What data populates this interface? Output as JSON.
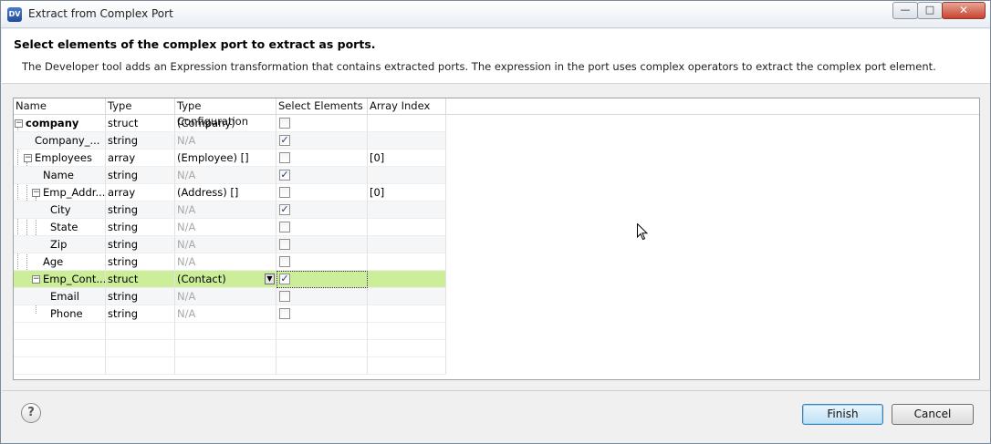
{
  "window": {
    "title": "Extract from Complex Port",
    "app_icon_text": "DV",
    "controls": {
      "minimize": "—",
      "maximize": "□",
      "close": "✕"
    }
  },
  "header": {
    "title": "Select elements of the complex port to extract as ports.",
    "description": "The Developer tool adds an Expression transformation that contains extracted ports. The expression in the port uses complex operators to extract the complex port element."
  },
  "table": {
    "columns": [
      "Name",
      "Type",
      "Type Configuration",
      "Select Elements",
      "Array Index"
    ],
    "rows": [
      {
        "name": "company",
        "type": "struct",
        "config": "(Company)",
        "checked": false,
        "index": ""
      },
      {
        "name": "Company_...",
        "type": "string",
        "config": "N/A",
        "checked": true,
        "index": ""
      },
      {
        "name": "Employees",
        "type": "array",
        "config": "(Employee) []",
        "checked": false,
        "index": "[0]"
      },
      {
        "name": "Name",
        "type": "string",
        "config": "N/A",
        "checked": true,
        "index": ""
      },
      {
        "name": "Emp_Addr...",
        "type": "array",
        "config": "(Address) []",
        "checked": false,
        "index": "[0]"
      },
      {
        "name": "City",
        "type": "string",
        "config": "N/A",
        "checked": true,
        "index": ""
      },
      {
        "name": "State",
        "type": "string",
        "config": "N/A",
        "checked": false,
        "index": ""
      },
      {
        "name": "Zip",
        "type": "string",
        "config": "N/A",
        "checked": false,
        "index": ""
      },
      {
        "name": "Age",
        "type": "string",
        "config": "N/A",
        "checked": false,
        "index": ""
      },
      {
        "name": "Emp_Cont...",
        "type": "struct",
        "config": "(Contact)",
        "checked": true,
        "index": ""
      },
      {
        "name": "Email",
        "type": "string",
        "config": "N/A",
        "checked": false,
        "index": ""
      },
      {
        "name": "Phone",
        "type": "string",
        "config": "N/A",
        "checked": false,
        "index": ""
      }
    ],
    "check_glyph": "✓",
    "expander_glyph": "−"
  },
  "footer": {
    "help": "?",
    "finish": "Finish",
    "cancel": "Cancel"
  }
}
